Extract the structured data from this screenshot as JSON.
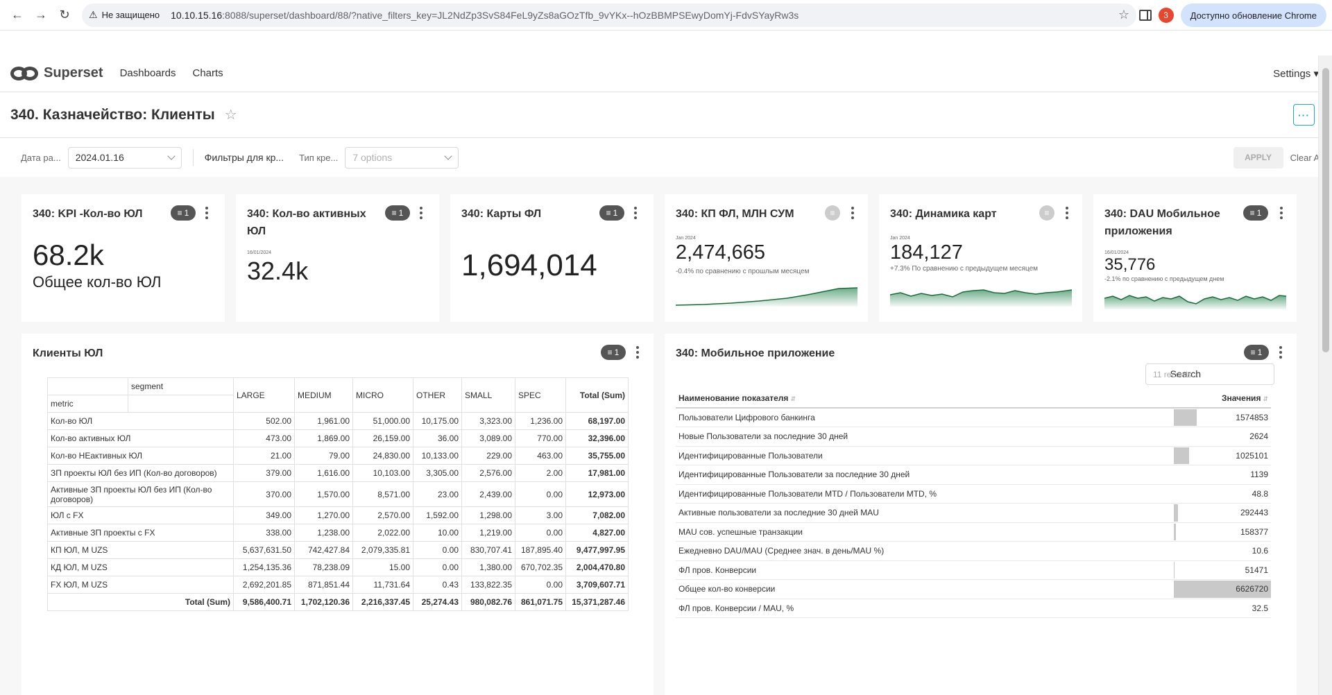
{
  "browser": {
    "insecure_label": "Не защищено",
    "url_host": "10.10.15.16",
    "url_path": ":8088/superset/dashboard/88/?native_filters_key=JL2NdZp3SvS84FeL9yZs8aGOzTfb_9vYKx--hOzBBMPSEwyDomYj-FdvSYayRw3s",
    "update_label": "Доступно обновление Chrome",
    "badge_count": "3"
  },
  "nav": {
    "brand": "Superset",
    "dashboards": "Dashboards",
    "charts": "Charts",
    "settings": "Settings ▾"
  },
  "dashboard": {
    "title": "340. Казначейство: Клиенты"
  },
  "filters": {
    "date_label": "Дата ра...",
    "date_value": "2024.01.16",
    "group_label": "Фильтры для кр...",
    "type_label": "Тип кре...",
    "type_placeholder": "7 options",
    "apply": "APPLY",
    "clear_all": "Clear All"
  },
  "kpis": [
    {
      "title": "340: KPI -Кол-во ЮЛ",
      "filter_count": "1",
      "value": "68.2k",
      "subtitle": "Общее кол-во ЮЛ"
    },
    {
      "title": "340: Кол-во активных ЮЛ",
      "filter_count": "1",
      "date": "16/01/2024",
      "value": "32.4k"
    },
    {
      "title": "340: Карты ФЛ",
      "filter_count": "1",
      "value": "1,694,014"
    },
    {
      "title": "340: КП ФЛ, МЛН СУМ",
      "date": "Jan 2024",
      "value": "2,474,665",
      "compare": "-0.4% по сравнению с прошлым месяцем"
    },
    {
      "title": "340: Динамика карт",
      "date": "Jan 2024",
      "value": "184,127",
      "compare": "+7.3% По сравнению с предыдущем месяцем"
    },
    {
      "title": "340: DAU Мобильное приложения",
      "filter_count": "1",
      "date": "16/01/2024",
      "value": "35,776",
      "compare": "-2.1% по сравнению с предыдущем днем"
    }
  ],
  "clients_table": {
    "title": "Клиенты ЮЛ",
    "filter_count": "1",
    "segment_label": "segment",
    "metric_label": "metric",
    "columns": [
      "LARGE",
      "MEDIUM",
      "MICRO",
      "OTHER",
      "SMALL",
      "SPEC",
      "Total (Sum)"
    ],
    "rows": [
      {
        "metric": "Кол-во ЮЛ",
        "values": [
          "502.00",
          "1,961.00",
          "51,000.00",
          "10,175.00",
          "3,323.00",
          "1,236.00",
          "68,197.00"
        ]
      },
      {
        "metric": "Кол-во активных ЮЛ",
        "values": [
          "473.00",
          "1,869.00",
          "26,159.00",
          "36.00",
          "3,089.00",
          "770.00",
          "32,396.00"
        ]
      },
      {
        "metric": "Кол-во НЕактивных ЮЛ",
        "values": [
          "21.00",
          "79.00",
          "24,830.00",
          "10,133.00",
          "229.00",
          "463.00",
          "35,755.00"
        ]
      },
      {
        "metric": "ЗП проекты ЮЛ без ИП (Кол-во договоров)",
        "values": [
          "379.00",
          "1,616.00",
          "10,103.00",
          "3,305.00",
          "2,576.00",
          "2.00",
          "17,981.00"
        ]
      },
      {
        "metric": "Активные ЗП проекты ЮЛ без ИП (Кол-во договоров)",
        "values": [
          "370.00",
          "1,570.00",
          "8,571.00",
          "23.00",
          "2,439.00",
          "0.00",
          "12,973.00"
        ]
      },
      {
        "metric": "ЮЛ с FX",
        "values": [
          "349.00",
          "1,270.00",
          "2,570.00",
          "1,592.00",
          "1,298.00",
          "3.00",
          "7,082.00"
        ]
      },
      {
        "metric": "Активные ЗП проекты с FX",
        "values": [
          "338.00",
          "1,238.00",
          "2,022.00",
          "10.00",
          "1,219.00",
          "0.00",
          "4,827.00"
        ]
      },
      {
        "metric": "КП ЮЛ, M UZS",
        "values": [
          "5,637,631.50",
          "742,427.84",
          "2,079,335.81",
          "0.00",
          "830,707.41",
          "187,895.40",
          "9,477,997.95"
        ]
      },
      {
        "metric": "КД ЮЛ, M UZS",
        "values": [
          "1,254,135.36",
          "78,238.09",
          "15.00",
          "0.00",
          "1,380.00",
          "670,702.35",
          "2,004,470.80"
        ]
      },
      {
        "metric": "FX ЮЛ, M UZS",
        "values": [
          "2,692,201.85",
          "871,851.44",
          "11,731.64",
          "0.43",
          "133,822.35",
          "0.00",
          "3,709,607.71"
        ]
      }
    ],
    "total_label": "Total (Sum)",
    "totals": [
      "9,586,400.71",
      "1,702,120.36",
      "2,216,337.45",
      "25,274.43",
      "980,082.76",
      "861,071.75",
      "15,371,287.46"
    ]
  },
  "mobile_table": {
    "title": "340: Мобильное приложение",
    "filter_count": "1",
    "search_label": "Search",
    "search_placeholder": "11 records...",
    "col_name": "Наименование показателя",
    "col_value": "Значения",
    "max_value": 6626720,
    "rows": [
      {
        "name": "Пользователи Цифрового банкинга",
        "value": 1574853,
        "display": "1574853"
      },
      {
        "name": "Новые Пользователи за последние 30 дней",
        "value": 2624,
        "display": "2624"
      },
      {
        "name": "Идентифицированные Пользователи",
        "value": 1025101,
        "display": "1025101"
      },
      {
        "name": "Идентифицированные Пользователи за последние 30 дней",
        "value": 1139,
        "display": "1139"
      },
      {
        "name": "Идентифицированные Пользователи MTD / Пользователи MTD, %",
        "value": 48.8,
        "display": "48.8"
      },
      {
        "name": "Активные пользователи за последние 30 дней MAU",
        "value": 292443,
        "display": "292443"
      },
      {
        "name": "MAU сов. успешные транзакции",
        "value": 158377,
        "display": "158377"
      },
      {
        "name": "Ежедневно DAU/MAU (Среднее знач. в день/MAU %)",
        "value": 10.6,
        "display": "10.6"
      },
      {
        "name": "ФЛ пров. Конверсии",
        "value": 51471,
        "display": "51471"
      },
      {
        "name": "Общее кол-во конверсии",
        "value": 6626720,
        "display": "6626720"
      },
      {
        "name": "ФЛ пров. Конверсии / MAU, %",
        "value": 32.5,
        "display": "32.5"
      }
    ]
  }
}
